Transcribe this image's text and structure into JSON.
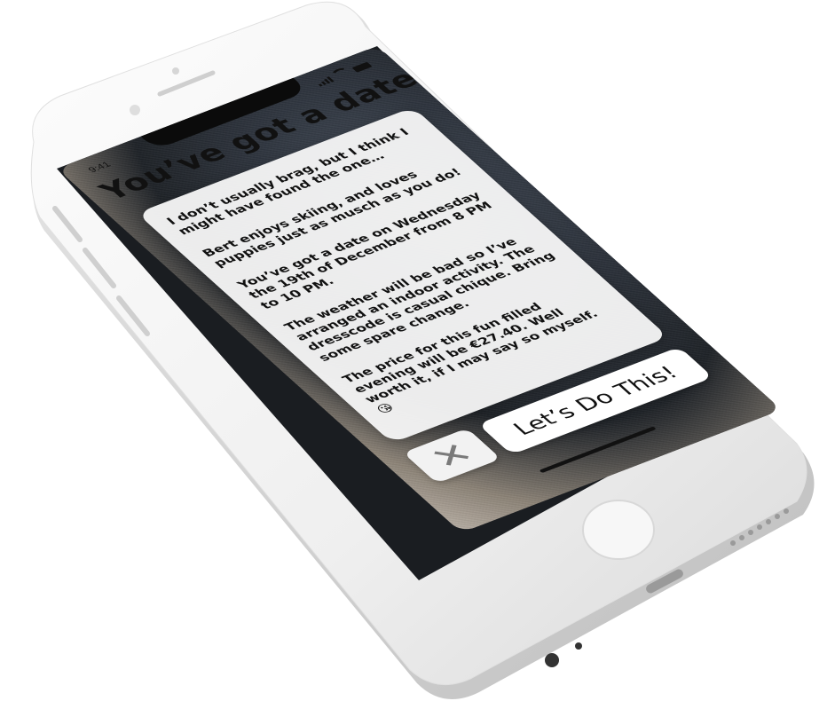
{
  "status_bar": {
    "time": "9:41",
    "icons": [
      "signal-icon",
      "wifi-icon",
      "battery-icon"
    ]
  },
  "title": "You’ve got a date!",
  "message": {
    "paragraphs": [
      "I don’t usually brag, but I think I might have found the one…",
      "Bert enjoys skiing, and loves puppies just as musch as you do!",
      "You’ve got a date on Wednesday the 19th of December from 8 PM to 10 PM.",
      "The weather will be bad so I’ve arranged an indoor activity. The dresscode is casual chique. Bring some spare change.",
      "The price for this fun filled evening will be €27.40. Well worth it, if I may say so myself. 😘"
    ]
  },
  "actions": {
    "close_label": "✕",
    "confirm_label": "Let’s Do This!"
  },
  "colors": {
    "phone_body": "#f4f4f4",
    "card_bg": "#f5f5f5",
    "text": "#111111",
    "close_icon": "#7a7a7a"
  }
}
